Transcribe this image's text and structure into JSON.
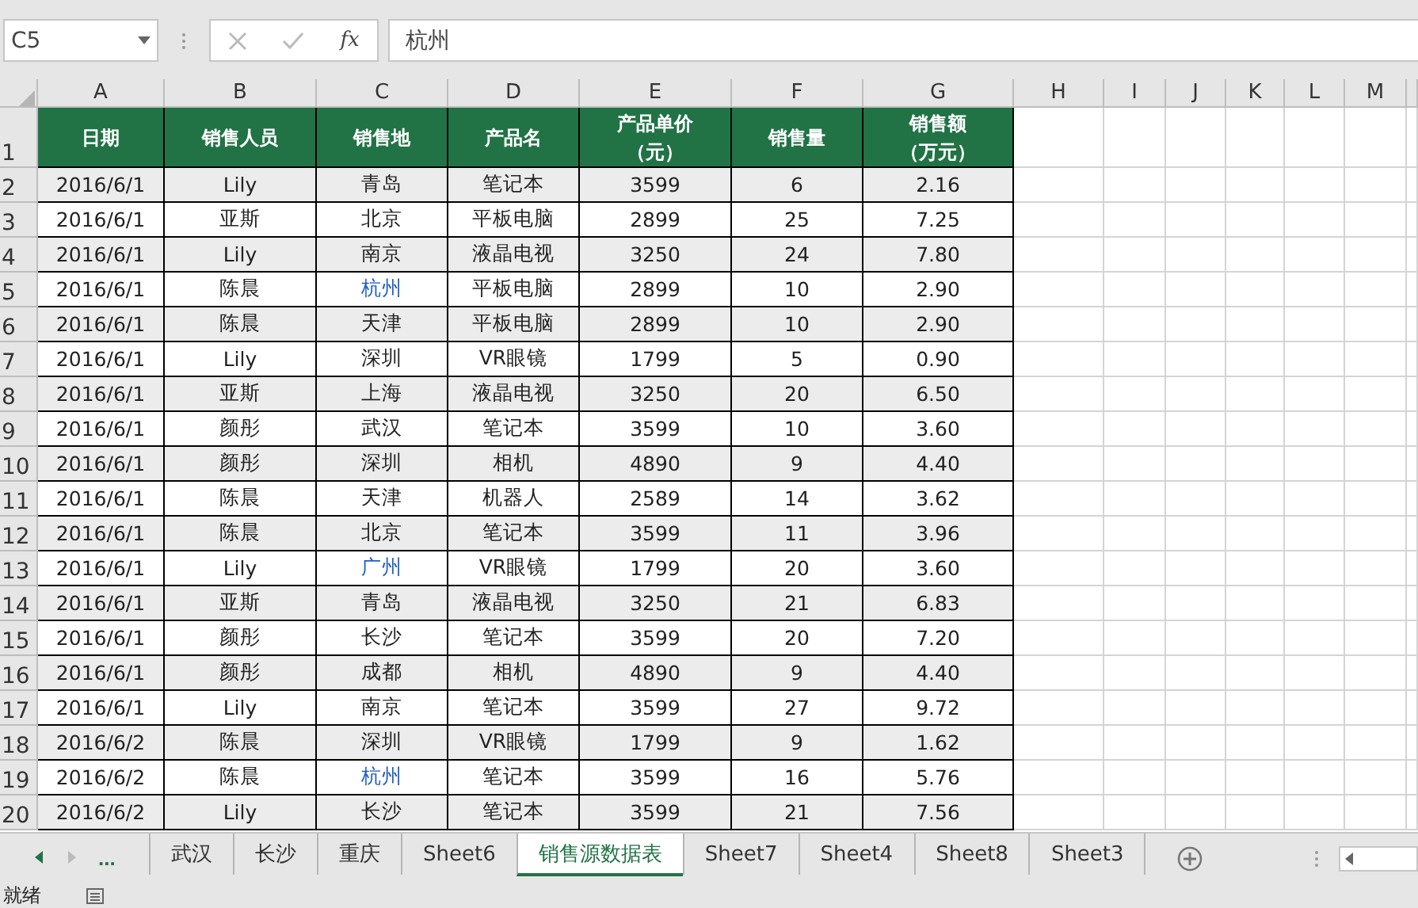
{
  "formula_bar": {
    "name_box": "C5",
    "fx_label": "fx",
    "value": "杭州"
  },
  "sheet": {
    "column_letters": [
      "A",
      "B",
      "C",
      "D",
      "E",
      "F",
      "G",
      "H",
      "I",
      "J",
      "K",
      "L",
      "M"
    ],
    "header_row_number": "1",
    "columns": [
      "日期",
      "销售人员",
      "销售地",
      "产品名",
      "产品单价（元）",
      "销售量",
      "销售额（万元）"
    ],
    "rows": [
      {
        "number": "2",
        "cells": [
          "2016/6/1",
          "Lily",
          "青岛",
          "笔记本",
          "3599",
          "6",
          "2.16"
        ],
        "city_highlighted": false
      },
      {
        "number": "3",
        "cells": [
          "2016/6/1",
          "亚斯",
          "北京",
          "平板电脑",
          "2899",
          "25",
          "7.25"
        ],
        "city_highlighted": false
      },
      {
        "number": "4",
        "cells": [
          "2016/6/1",
          "Lily",
          "南京",
          "液晶电视",
          "3250",
          "24",
          "7.80"
        ],
        "city_highlighted": false
      },
      {
        "number": "5",
        "cells": [
          "2016/6/1",
          "陈晨",
          "杭州",
          "平板电脑",
          "2899",
          "10",
          "2.90"
        ],
        "city_highlighted": true
      },
      {
        "number": "6",
        "cells": [
          "2016/6/1",
          "陈晨",
          "天津",
          "平板电脑",
          "2899",
          "10",
          "2.90"
        ],
        "city_highlighted": false
      },
      {
        "number": "7",
        "cells": [
          "2016/6/1",
          "Lily",
          "深圳",
          "VR眼镜",
          "1799",
          "5",
          "0.90"
        ],
        "city_highlighted": false
      },
      {
        "number": "8",
        "cells": [
          "2016/6/1",
          "亚斯",
          "上海",
          "液晶电视",
          "3250",
          "20",
          "6.50"
        ],
        "city_highlighted": false
      },
      {
        "number": "9",
        "cells": [
          "2016/6/1",
          "颜彤",
          "武汉",
          "笔记本",
          "3599",
          "10",
          "3.60"
        ],
        "city_highlighted": false
      },
      {
        "number": "10",
        "cells": [
          "2016/6/1",
          "颜彤",
          "深圳",
          "相机",
          "4890",
          "9",
          "4.40"
        ],
        "city_highlighted": false
      },
      {
        "number": "11",
        "cells": [
          "2016/6/1",
          "陈晨",
          "天津",
          "机器人",
          "2589",
          "14",
          "3.62"
        ],
        "city_highlighted": false
      },
      {
        "number": "12",
        "cells": [
          "2016/6/1",
          "陈晨",
          "北京",
          "笔记本",
          "3599",
          "11",
          "3.96"
        ],
        "city_highlighted": false
      },
      {
        "number": "13",
        "cells": [
          "2016/6/1",
          "Lily",
          "广州",
          "VR眼镜",
          "1799",
          "20",
          "3.60"
        ],
        "city_highlighted": true
      },
      {
        "number": "14",
        "cells": [
          "2016/6/1",
          "亚斯",
          "青岛",
          "液晶电视",
          "3250",
          "21",
          "6.83"
        ],
        "city_highlighted": false
      },
      {
        "number": "15",
        "cells": [
          "2016/6/1",
          "颜彤",
          "长沙",
          "笔记本",
          "3599",
          "20",
          "7.20"
        ],
        "city_highlighted": false
      },
      {
        "number": "16",
        "cells": [
          "2016/6/1",
          "颜彤",
          "成都",
          "相机",
          "4890",
          "9",
          "4.40"
        ],
        "city_highlighted": false
      },
      {
        "number": "17",
        "cells": [
          "2016/6/1",
          "Lily",
          "南京",
          "笔记本",
          "3599",
          "27",
          "9.72"
        ],
        "city_highlighted": false
      },
      {
        "number": "18",
        "cells": [
          "2016/6/2",
          "陈晨",
          "深圳",
          "VR眼镜",
          "1799",
          "9",
          "1.62"
        ],
        "city_highlighted": false
      },
      {
        "number": "19",
        "cells": [
          "2016/6/2",
          "陈晨",
          "杭州",
          "笔记本",
          "3599",
          "16",
          "5.76"
        ],
        "city_highlighted": true
      },
      {
        "number": "20",
        "cells": [
          "2016/6/2",
          "Lily",
          "长沙",
          "笔记本",
          "3599",
          "21",
          "7.56"
        ],
        "city_highlighted": false
      }
    ]
  },
  "tab_bar": {
    "more_label": "...",
    "tabs": [
      {
        "label": "武汉",
        "selected": false
      },
      {
        "label": "长沙",
        "selected": false
      },
      {
        "label": "重庆",
        "selected": false
      },
      {
        "label": "Sheet6",
        "selected": false
      },
      {
        "label": "销售源数据表",
        "selected": true
      },
      {
        "label": "Sheet7",
        "selected": false
      },
      {
        "label": "Sheet4",
        "selected": false
      },
      {
        "label": "Sheet8",
        "selected": false
      },
      {
        "label": "Sheet3",
        "selected": false
      }
    ]
  },
  "status_bar": {
    "text": "就绪"
  }
}
